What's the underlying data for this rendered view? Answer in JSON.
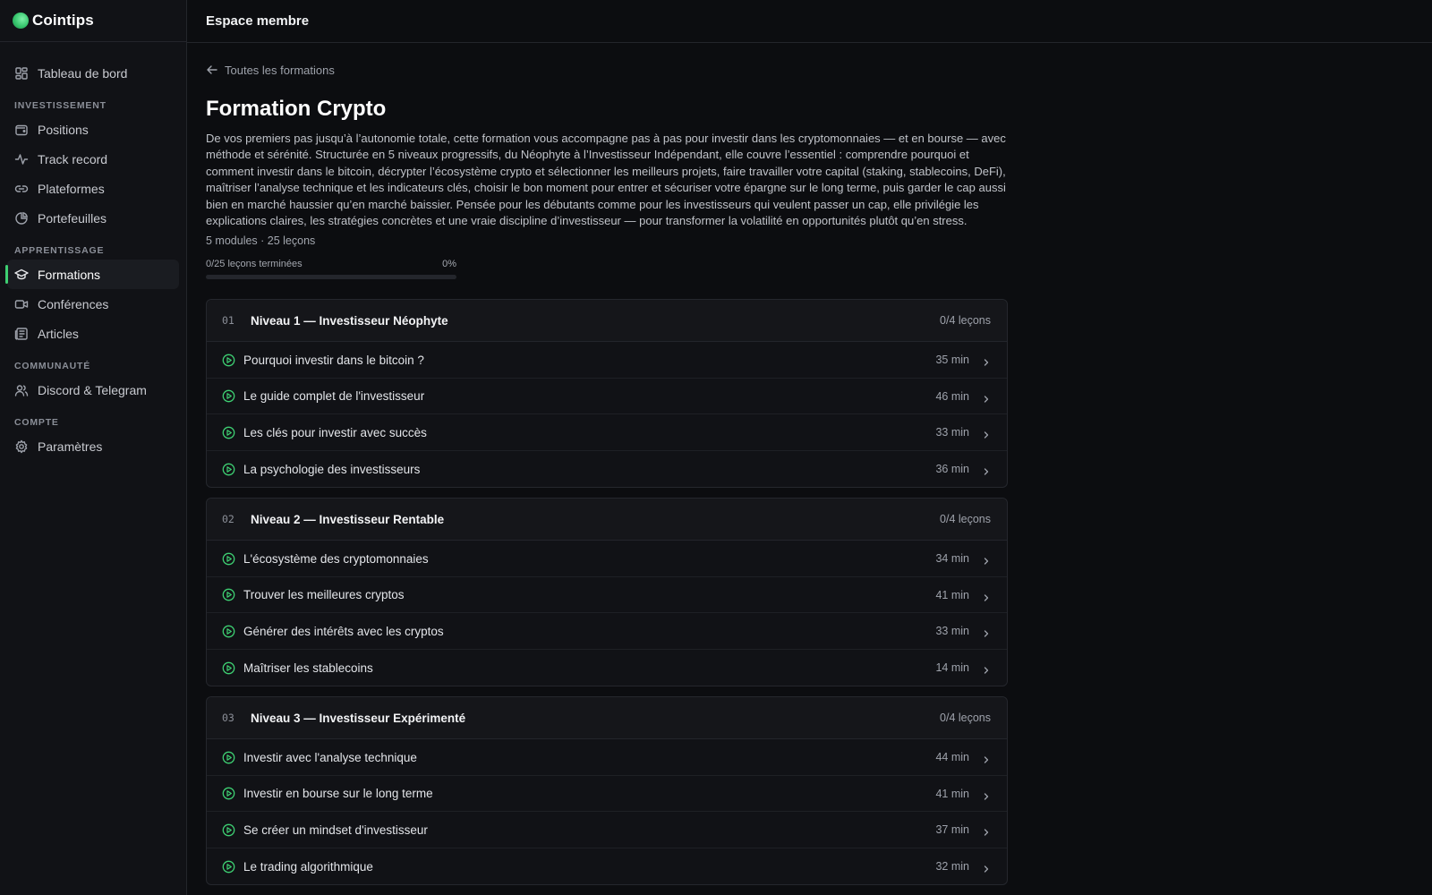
{
  "brand": {
    "name": "Cointips",
    "accent": "#3ecf72"
  },
  "topbar": {
    "title": "Espace membre"
  },
  "sidebar": {
    "top": [
      {
        "label": "Tableau de bord",
        "icon": "dashboard-icon"
      }
    ],
    "sections": [
      {
        "title": "INVESTISSEMENT",
        "items": [
          {
            "label": "Positions",
            "icon": "wallet-icon"
          },
          {
            "label": "Track record",
            "icon": "activity-icon"
          },
          {
            "label": "Plateformes",
            "icon": "link-icon"
          },
          {
            "label": "Portefeuilles",
            "icon": "pie-chart-icon"
          }
        ]
      },
      {
        "title": "APPRENTISSAGE",
        "items": [
          {
            "label": "Formations",
            "icon": "graduation-cap-icon",
            "active": true
          },
          {
            "label": "Conférences",
            "icon": "video-icon"
          },
          {
            "label": "Articles",
            "icon": "newspaper-icon"
          }
        ]
      },
      {
        "title": "COMMUNAUTÉ",
        "items": [
          {
            "label": "Discord & Telegram",
            "icon": "users-icon"
          }
        ]
      },
      {
        "title": "COMPTE",
        "items": [
          {
            "label": "Paramètres",
            "icon": "gear-icon"
          }
        ]
      }
    ]
  },
  "main": {
    "back_label": "Toutes les formations",
    "title": "Formation Crypto",
    "description": "De vos premiers pas jusqu’à l’autonomie totale, cette formation vous accompagne pas à pas pour investir dans les cryptomonnaies — et en bourse — avec méthode et sérénité. Structurée en 5 niveaux progressifs, du Néophyte à l’Investisseur Indépendant, elle couvre l’essentiel : comprendre pourquoi et comment investir dans le bitcoin, décrypter l’écosystème crypto et sélectionner les meilleurs projets, faire travailler votre capital (staking, stablecoins, DeFi), maîtriser l’analyse technique et les indicateurs clés, choisir le bon moment pour entrer et sécuriser votre épargne sur le long terme, puis garder le cap aussi bien en marché haussier qu’en marché baissier. Pensée pour les débutants comme pour les investisseurs qui veulent passer un cap, elle privilégie les explications claires, les stratégies concrètes et une vraie discipline d’investisseur — pour transformer la volatilité en opportunités plutôt qu’en stress.",
    "meta": "5 modules · 25 leçons",
    "progress": {
      "label": "0/25 leçons terminées",
      "percent_label": "0%",
      "fraction": 0
    },
    "modules": [
      {
        "num": "01",
        "title": "Niveau 1 — Investisseur Néophyte",
        "count": "0/4 leçons",
        "lessons": [
          {
            "title": "Pourquoi investir dans le bitcoin ?",
            "duration": "35 min"
          },
          {
            "title": "Le guide complet de l'investisseur",
            "duration": "46 min"
          },
          {
            "title": "Les clés pour investir avec succès",
            "duration": "33 min"
          },
          {
            "title": "La psychologie des investisseurs",
            "duration": "36 min"
          }
        ]
      },
      {
        "num": "02",
        "title": "Niveau 2 — Investisseur Rentable",
        "count": "0/4 leçons",
        "lessons": [
          {
            "title": "L'écosystème des cryptomonnaies",
            "duration": "34 min"
          },
          {
            "title": "Trouver les meilleures cryptos",
            "duration": "41 min"
          },
          {
            "title": "Générer des intérêts avec les cryptos",
            "duration": "33 min"
          },
          {
            "title": "Maîtriser les stablecoins",
            "duration": "14 min"
          }
        ]
      },
      {
        "num": "03",
        "title": "Niveau 3 — Investisseur Expérimenté",
        "count": "0/4 leçons",
        "lessons": [
          {
            "title": "Investir avec l'analyse technique",
            "duration": "44 min"
          },
          {
            "title": "Investir en bourse sur le long terme",
            "duration": "41 min"
          },
          {
            "title": "Se créer un mindset d'investisseur",
            "duration": "37 min"
          },
          {
            "title": "Le trading algorithmique",
            "duration": "32 min"
          }
        ]
      }
    ]
  }
}
